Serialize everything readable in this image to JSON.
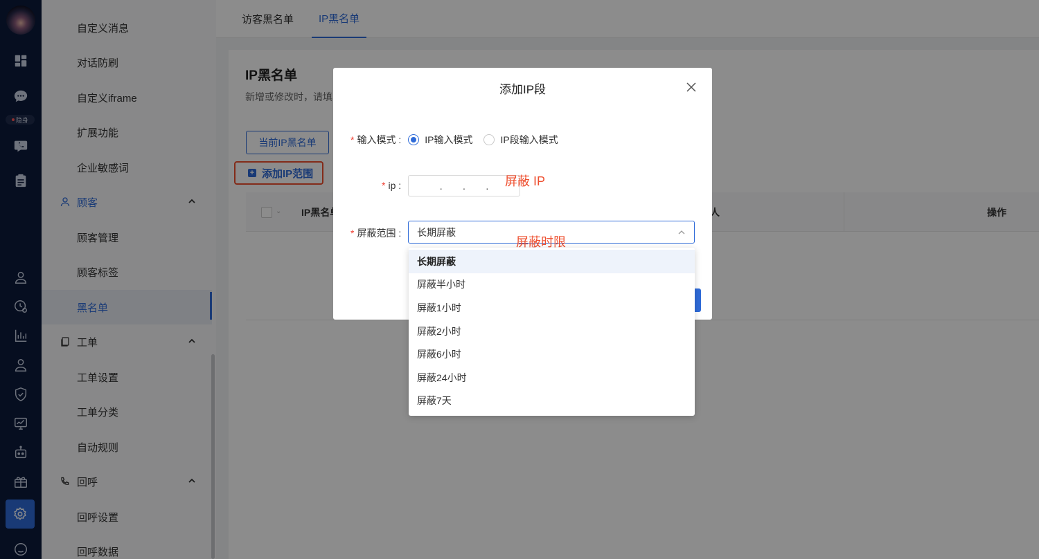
{
  "rail": {
    "status_badge": "隐身",
    "icons": [
      "dashboard-icon",
      "chat-icon",
      "phone-chat-icon",
      "clipboard-icon",
      "user-icon",
      "history-icon",
      "bar-chart-icon",
      "team-icon",
      "shield-icon",
      "monitor-icon",
      "robot-icon",
      "gift-icon",
      "gear-icon",
      "message-icon"
    ]
  },
  "sidebar": {
    "items": [
      {
        "label": "自定义消息"
      },
      {
        "label": "对话防刷"
      },
      {
        "label": "自定义iframe"
      },
      {
        "label": "扩展功能"
      },
      {
        "label": "企业敏感词"
      },
      {
        "label": "顾客"
      },
      {
        "label": "顾客管理"
      },
      {
        "label": "顾客标签"
      },
      {
        "label": "黑名单"
      },
      {
        "label": "工单"
      },
      {
        "label": "工单设置"
      },
      {
        "label": "工单分类"
      },
      {
        "label": "自动规则"
      },
      {
        "label": "回呼"
      },
      {
        "label": "回呼设置"
      },
      {
        "label": "回呼数据"
      }
    ]
  },
  "tabs": [
    {
      "label": "访客黑名单"
    },
    {
      "label": "IP黑名单"
    }
  ],
  "main": {
    "title": "IP黑名单",
    "description": "新增或修改时，请填",
    "current_list_button": "当前IP黑名单",
    "add_range_link": "添加IP范围",
    "table": {
      "columns": [
        "IP黑名单",
        "人",
        "操作"
      ]
    }
  },
  "modal": {
    "title": "添加IP段",
    "input_mode_label": "输入模式 :",
    "radio_ip": "IP输入模式",
    "radio_ip_range": "IP段输入模式",
    "ip_label": "ip :",
    "ip_dots": [
      ".",
      ".",
      "."
    ],
    "block_range_label": "屏蔽范围 :",
    "block_range_value": "长期屏蔽"
  },
  "annotations": {
    "block_ip": "屏蔽 IP",
    "block_duration": "屏蔽时限"
  },
  "dropdown": {
    "options": [
      "长期屏蔽",
      "屏蔽半小时",
      "屏蔽1小时",
      "屏蔽2小时",
      "屏蔽6小时",
      "屏蔽24小时",
      "屏蔽7天"
    ],
    "selected": "长期屏蔽"
  },
  "colors": {
    "accent": "#2f6bd8",
    "rail_bg": "#0b1a3b",
    "annotation": "#ee4f2f"
  }
}
